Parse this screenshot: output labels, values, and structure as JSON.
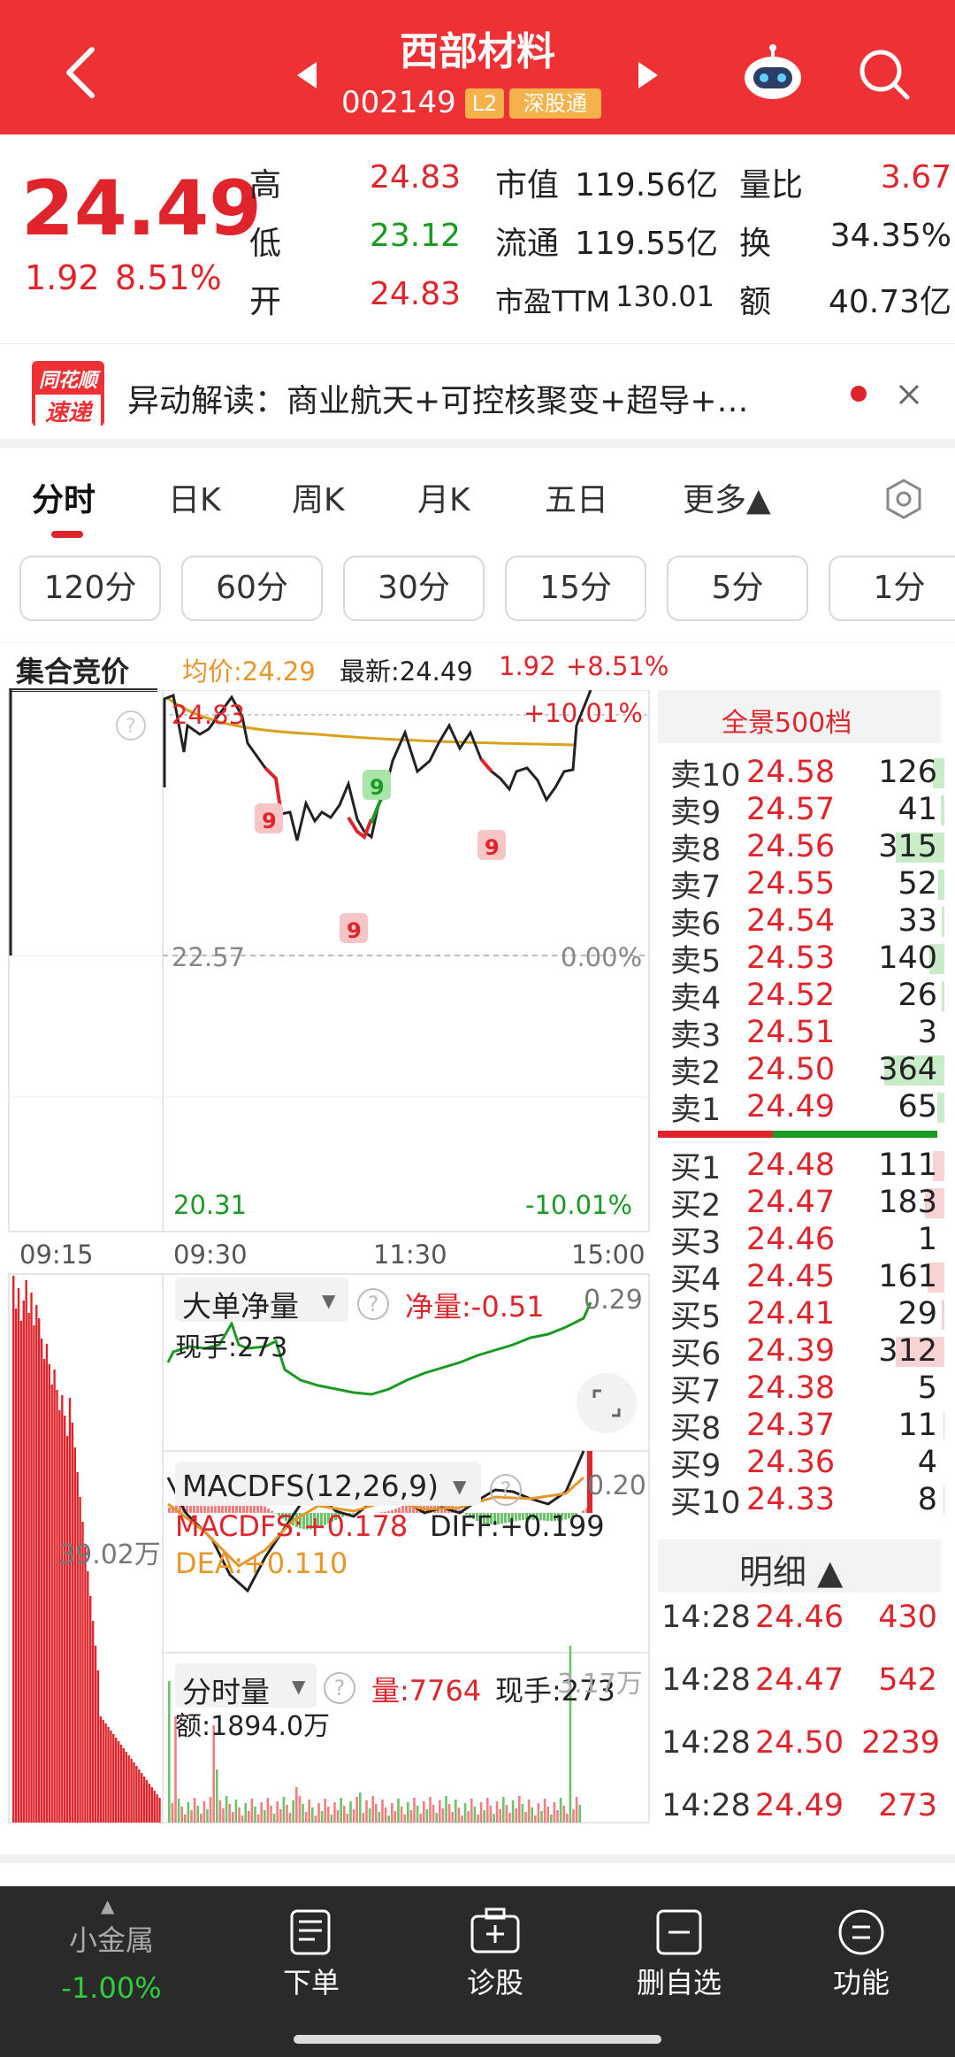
{
  "header": {
    "title": "西部材料",
    "code": "002149",
    "badge_l2": "L2",
    "badge_market": "深股通"
  },
  "quote": {
    "price": "24.49",
    "change": "1.92",
    "change_pct": "8.51%",
    "rows": [
      {
        "l1": "高",
        "v1": "24.83",
        "l2": "市值",
        "v2": "119.56亿",
        "l3": "量比",
        "v3": "3.67"
      },
      {
        "l1": "低",
        "v1": "23.12",
        "l2": "流通",
        "v2": "119.55亿",
        "l3": "换",
        "v3": "34.35%"
      },
      {
        "l1": "开",
        "v1": "24.83",
        "l2": "市盈TTM",
        "v2": "130.01",
        "l3": "额",
        "v3": "40.73亿"
      }
    ]
  },
  "news": {
    "logo_top": "同花顺",
    "logo_bottom": "速递",
    "text": "异动解读：商业航天+可控核聚变+超导+…"
  },
  "tabs": [
    "分时",
    "日K",
    "周K",
    "月K",
    "五日",
    "更多▲"
  ],
  "periods": [
    "120分",
    "60分",
    "30分",
    "15分",
    "5分",
    "1分"
  ],
  "chart_header": {
    "auction": "集合竞价",
    "avg": "均价:24.29",
    "latest": "最新:24.49",
    "chg": "1.92",
    "pct": "+8.51%"
  },
  "chart_labels": {
    "top_price": "24.83",
    "top_pct": "+10.01%",
    "mid_price": "22.57",
    "mid_pct": "0.00%",
    "low_price": "20.31",
    "low_pct": "-10.01%",
    "t1": "09:15",
    "t2": "09:30",
    "t3": "11:30",
    "t4": "15:00",
    "signal": "9"
  },
  "panel_bigorder": {
    "title": "大单净量",
    "net": "净量:-0.51",
    "hand": "现手:273",
    "scale": "0.29"
  },
  "panel_macd": {
    "title": "MACDFS(12,26,9)",
    "macd": "MACDFS:+0.178",
    "diff": "DIFF:+0.199",
    "dea": "DEA:+0.110",
    "scale": "0.20",
    "left_vol": "39.02万"
  },
  "panel_vol": {
    "title": "分时量",
    "vol": "量:7764",
    "hand": "现手:273",
    "amount": "额:1894.0万",
    "scale": "3.17万"
  },
  "orderbook": {
    "title": "全景500档",
    "asks": [
      {
        "label": "卖10",
        "price": "24.58",
        "vol": "126",
        "bar": 0.12
      },
      {
        "label": "卖9",
        "price": "24.57",
        "vol": "41",
        "bar": 0.04
      },
      {
        "label": "卖8",
        "price": "24.56",
        "vol": "315",
        "bar": 0.5
      },
      {
        "label": "卖7",
        "price": "24.55",
        "vol": "52",
        "bar": 0.06
      },
      {
        "label": "卖6",
        "price": "24.54",
        "vol": "33",
        "bar": 0.03
      },
      {
        "label": "卖5",
        "price": "24.53",
        "vol": "140",
        "bar": 0.15
      },
      {
        "label": "卖4",
        "price": "24.52",
        "vol": "26",
        "bar": 0.03
      },
      {
        "label": "卖3",
        "price": "24.51",
        "vol": "3",
        "bar": 0.0
      },
      {
        "label": "卖2",
        "price": "24.50",
        "vol": "364",
        "bar": 0.62
      },
      {
        "label": "卖1",
        "price": "24.49",
        "vol": "65",
        "bar": 0.07
      }
    ],
    "bids": [
      {
        "label": "买1",
        "price": "24.48",
        "vol": "111",
        "bar": 0.12
      },
      {
        "label": "买2",
        "price": "24.47",
        "vol": "183",
        "bar": 0.2
      },
      {
        "label": "买3",
        "price": "24.46",
        "vol": "1",
        "bar": 0.0
      },
      {
        "label": "买4",
        "price": "24.45",
        "vol": "161",
        "bar": 0.17
      },
      {
        "label": "买5",
        "price": "24.41",
        "vol": "29",
        "bar": 0.03
      },
      {
        "label": "买6",
        "price": "24.39",
        "vol": "312",
        "bar": 0.5
      },
      {
        "label": "买7",
        "price": "24.38",
        "vol": "5",
        "bar": 0.0
      },
      {
        "label": "买8",
        "price": "24.37",
        "vol": "11",
        "bar": 0.01
      },
      {
        "label": "买9",
        "price": "24.36",
        "vol": "4",
        "bar": 0.0
      },
      {
        "label": "买10",
        "price": "24.33",
        "vol": "8",
        "bar": 0.01
      }
    ],
    "detail_title": "明细 ▲",
    "details": [
      {
        "time": "14:28",
        "price": "24.46",
        "vol": "430"
      },
      {
        "time": "14:28",
        "price": "24.47",
        "vol": "542"
      },
      {
        "time": "14:28",
        "price": "24.50",
        "vol": "2239"
      },
      {
        "time": "14:28",
        "price": "24.49",
        "vol": "273"
      }
    ]
  },
  "bottom": {
    "left_name": "小金属",
    "left_pct": "-1.00%",
    "items": [
      {
        "label": "下单",
        "icon": "order-icon"
      },
      {
        "label": "诊股",
        "icon": "diagnose-icon"
      },
      {
        "label": "删自选",
        "icon": "remove-watchlist-icon"
      },
      {
        "label": "功能",
        "icon": "menu-icon"
      }
    ]
  },
  "colors": {
    "brand": "#ee3134",
    "up": "#e0242b",
    "down": "#1a9a23",
    "avg": "#d9a21b",
    "dark": "#2a2a2a"
  }
}
